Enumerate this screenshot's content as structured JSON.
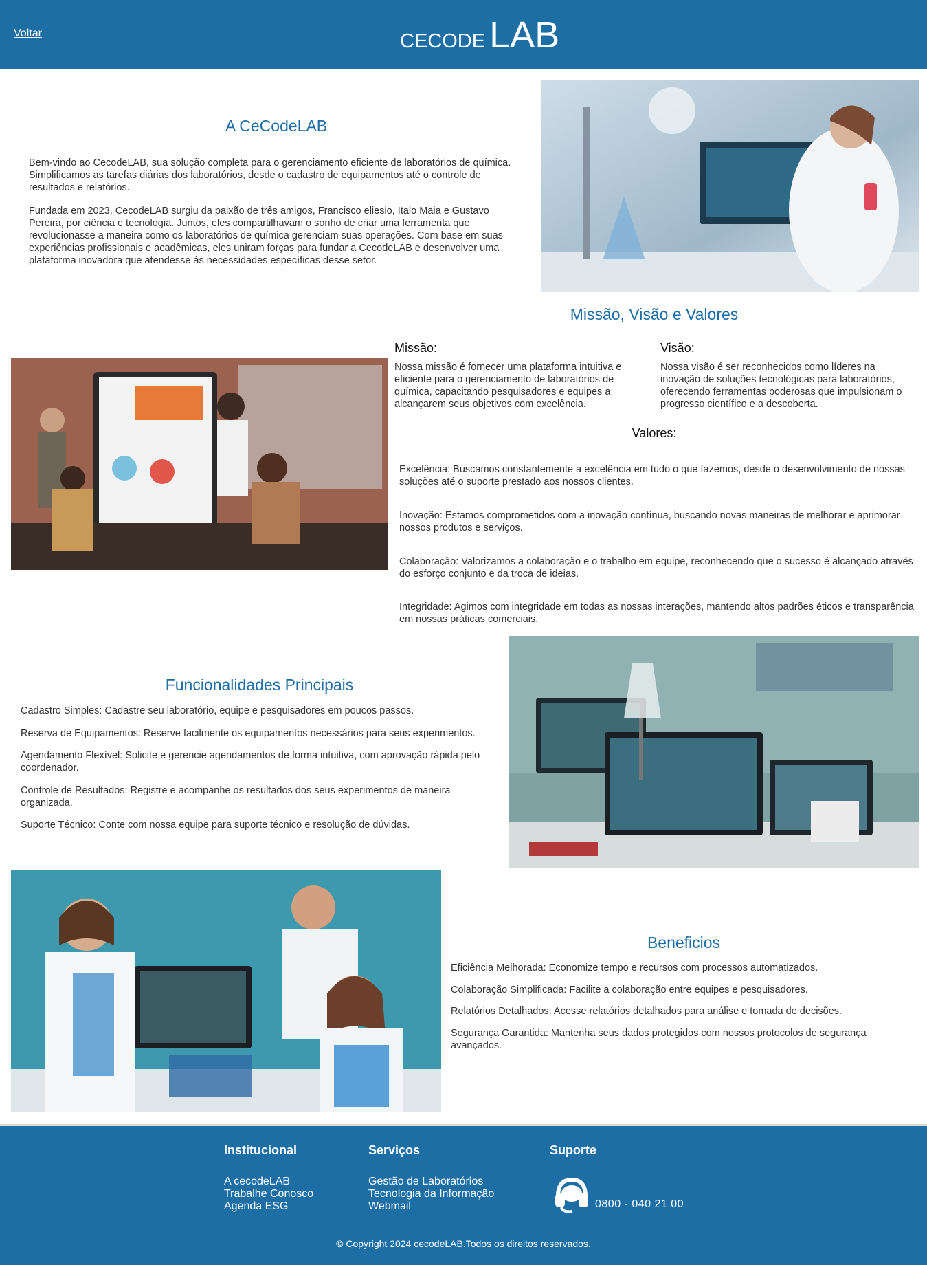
{
  "header": {
    "back_label": "Voltar",
    "logo_small": "CECODE",
    "logo_big": "LAB"
  },
  "about": {
    "title": "A CeCodeLAB",
    "p1": "Bem-vindo ao CecodeLAB, sua solução completa para o gerenciamento eficiente de laboratórios de química. Simplificamos as tarefas diárias dos laboratórios, desde o cadastro de equipamentos até o controle de resultados e relatórios.",
    "p2": "Fundada em 2023, CecodeLAB surgiu da paixão de três amigos, Francisco eliesio, Italo Maia e Gustavo Pereira, por ciência e tecnologia. Juntos, eles compartilhavam o sonho de criar uma ferramenta que revolucionasse a maneira como os laboratórios de química gerenciam suas operações. Com base em suas experiências profissionais e acadêmicas, eles uniram forças para fundar a CecodeLAB e desenvolver uma plataforma inovadora que atendesse às necessidades específicas desse setor."
  },
  "mvv": {
    "title": "Missão, Visão e Valores",
    "mission_title": "Missão:",
    "mission_text": "Nossa missão é fornecer uma plataforma intuitiva e eficiente para o gerenciamento de laboratórios de química, capacitando pesquisadores e equipes a alcançarem seus objetivos com excelência.",
    "vision_title": "Visão:",
    "vision_text": "Nossa visão é ser reconhecidos como líderes na inovação de soluções tecnológicas para laboratórios, oferecendo ferramentas poderosas que impulsionam o progresso científico e a descoberta.",
    "values_title": "Valores:",
    "values": [
      "Excelência: Buscamos constantemente a excelência em tudo o que fazemos, desde o desenvolvimento de nossas soluções até o suporte prestado aos nossos clientes.",
      "Inovação: Estamos comprometidos com a inovação contínua, buscando novas maneiras de melhorar e aprimorar nossos produtos e serviços.",
      "Colaboração: Valorizamos a colaboração e o trabalho em equipe, reconhecendo que o sucesso é alcançado através do esforço conjunto e da troca de ideias.",
      "Integridade: Agimos com integridade em todas as nossas interações, mantendo altos padrões éticos e transparência em nossas práticas comerciais."
    ]
  },
  "features": {
    "title": "Funcionalidades Principais",
    "items": [
      "Cadastro Simples: Cadastre seu laboratório, equipe e pesquisadores em poucos passos.",
      "Reserva de Equipamentos: Reserve facilmente os equipamentos necessários para seus experimentos.",
      "Agendamento Flexível: Solicite e gerencie agendamentos de forma intuitiva, com aprovação rápida pelo coordenador.",
      "Controle de Resultados: Registre e acompanhe os resultados dos seus experimentos de maneira organizada.",
      "Suporte Técnico: Conte com nossa equipe para suporte técnico e resolução de dúvidas."
    ]
  },
  "benefits": {
    "title": "Beneficios",
    "items": [
      "Eficiência Melhorada: Economize tempo e recursos com processos automatizados.",
      "Colaboração Simplificada: Facilite a colaboração entre equipes e pesquisadores.",
      "Relatórios Detalhados: Acesse relatórios detalhados para análise e tomada de decisões.",
      "Segurança Garantida: Mantenha seus dados protegidos com nossos protocolos de segurança avançados."
    ]
  },
  "footer": {
    "col1_title": "Institucional",
    "col1_links": [
      "A cecodeLAB",
      "Trabalhe Conosco",
      "Agenda ESG"
    ],
    "col2_title": "Serviços",
    "col2_links": [
      "Gestão de Laboratórios",
      "Tecnologia da Informação",
      "Webmail"
    ],
    "col3_title": "Suporte",
    "phone": "0800 - 040 21 00",
    "copyright": "© Copyright 2024 cecodeLAB.Todos os direitos reservados."
  },
  "icons": {
    "support": "headset-icon"
  },
  "colors": {
    "brand": "#1c6ea4",
    "text": "#333333",
    "white": "#ffffff"
  }
}
